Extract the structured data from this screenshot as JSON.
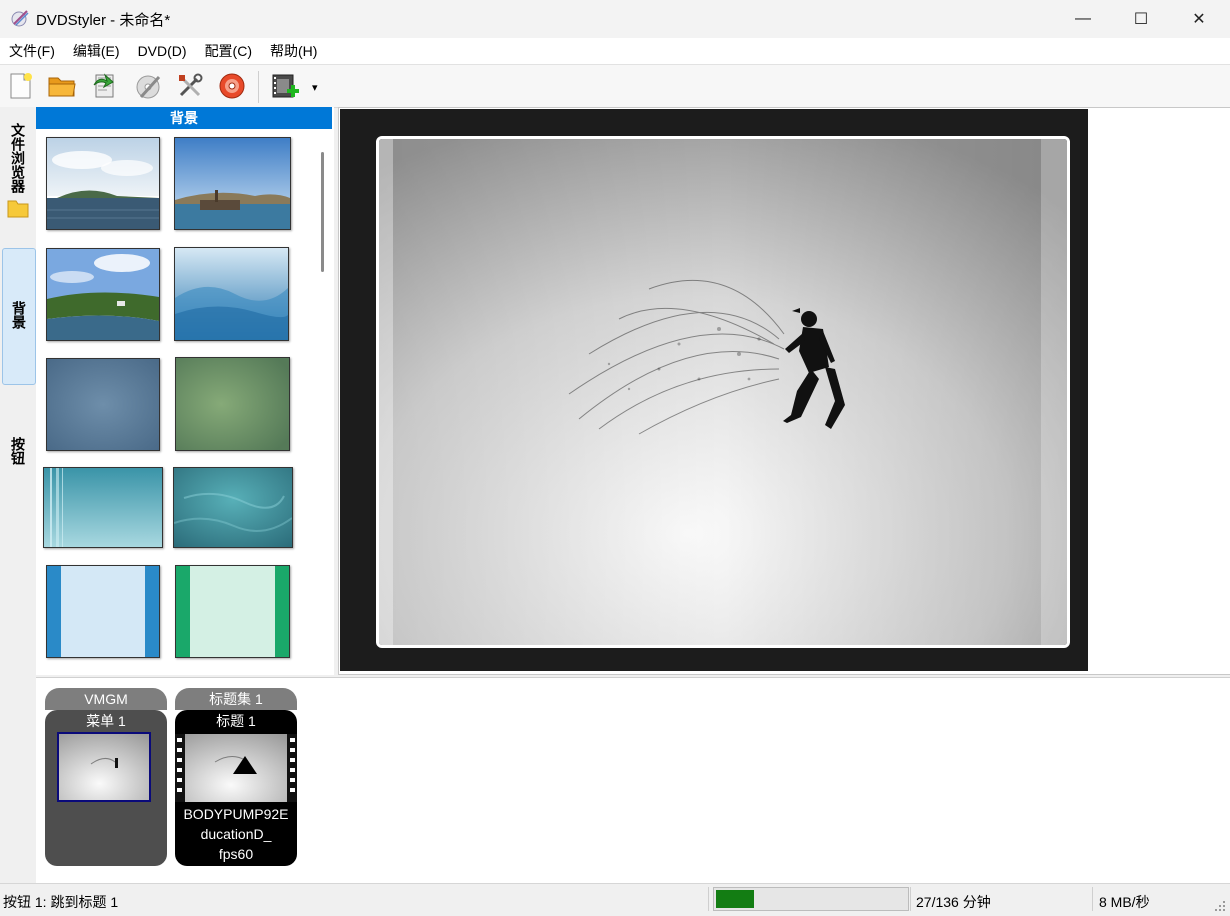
{
  "window": {
    "title": "DVDStyler - 未命名*",
    "minimize": "—",
    "maximize": "☐",
    "close": "✕"
  },
  "menu": [
    "文件(F)",
    "编辑(E)",
    "DVD(D)",
    "配置(C)",
    "帮助(H)"
  ],
  "toolbar": {
    "icons": [
      "new-file-icon",
      "open-folder-icon",
      "save-icon",
      "burn-dvd-icon",
      "settings-tools-icon",
      "dvd-disc-icon",
      "add-video-icon"
    ],
    "dropdown": "▾"
  },
  "side_tabs": {
    "file_browser": "文件浏览器",
    "background": "背景",
    "buttons": "按钮"
  },
  "background_panel": {
    "header": "背景",
    "thumbnails": [
      "sea-landscape",
      "boat-coast",
      "coast-forest",
      "blue-waves",
      "blue-blur",
      "green-blur",
      "teal-stripes",
      "teal-texture",
      "light-blue-border",
      "light-green-border"
    ]
  },
  "titleset": {
    "vmgm": {
      "header": "VMGM",
      "item_label": "菜单 1"
    },
    "titleset1": {
      "header": "标题集 1",
      "item_label": "标题 1",
      "caption_line1": "BODYPUMP92E",
      "caption_line2": "ducationD_",
      "caption_line3": "fps60"
    }
  },
  "status": {
    "text": "按钮 1: 跳到标题 1",
    "progress_fraction": 0.2,
    "duration": "27/136 分钟",
    "rate": "8 MB/秒"
  },
  "colors": {
    "accent": "#0078d7",
    "progress": "#137d13"
  }
}
